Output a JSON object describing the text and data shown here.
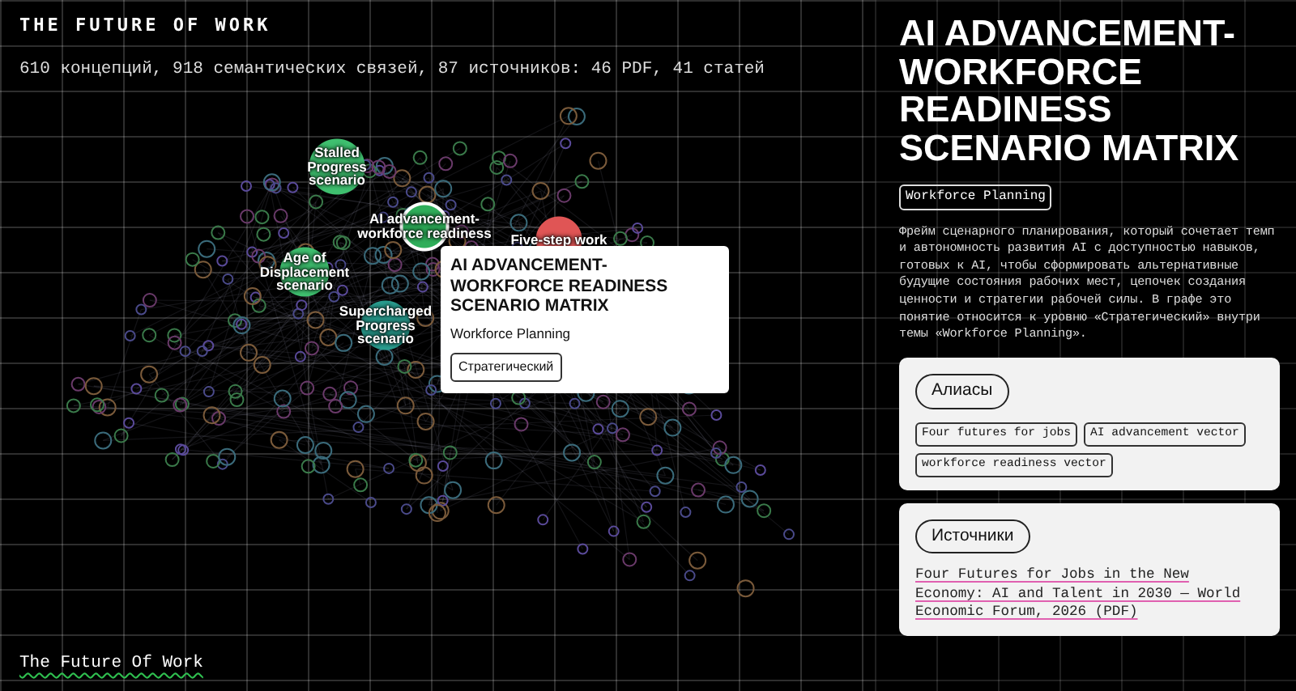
{
  "header": {
    "title": "THE FUTURE OF WORK",
    "stats": "610 концепций, 918 семантических связей, 87 источников: 46 PDF, 41 статей"
  },
  "graph": {
    "nodes": [
      {
        "label": "Stalled Progress scenario",
        "color": "#3fbf6f",
        "selected": false
      },
      {
        "label": "AI advancement-workforce readiness",
        "color": "#2fae5a",
        "selected": true
      },
      {
        "label": "Age of Displacement scenario",
        "color": "#3fbf6f",
        "selected": false
      },
      {
        "label": "Supercharged Progress scenario",
        "color": "#2a9d8f",
        "selected": false
      },
      {
        "label": "Five-step work",
        "color": "#e05555",
        "selected": false
      }
    ]
  },
  "tooltip": {
    "title": "AI ADVANCEMENT-WORKFORCE READINESS SCENARIO MATRIX",
    "theme": "Workforce Planning",
    "level": "Стратегический"
  },
  "footer_link": "The Future Of Work",
  "detail": {
    "title": "AI ADVANCEMENT-WORKFORCE READINESS SCENARIO MATRIX",
    "theme_tag": "Workforce Planning",
    "description": "Фрейм сценарного планирования, который сочетает темп и автономность развития AI с доступностью навыков, готовых к AI, чтобы сформировать альтернативные будущие состояния рабочих мест, цепочек создания ценности и стратегии рабочей силы. В графе это понятие относится к уровню «Стратегический» внутри темы «Workforce Planning».",
    "aliases": {
      "heading": "Алиасы",
      "items": [
        "Four futures for jobs",
        "AI advancement vector",
        "workforce readiness vector"
      ]
    },
    "sources": {
      "heading": "Источники",
      "items": [
        "Four Futures for Jobs in the New Economy: AI and Talent in 2030 — World Economic Forum, 2026 (PDF)"
      ]
    }
  }
}
